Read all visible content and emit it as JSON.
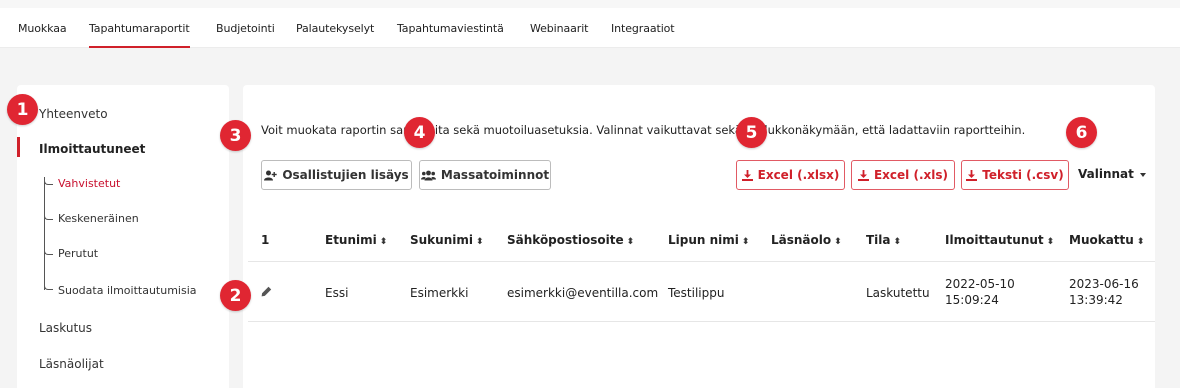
{
  "top_tabs": [
    "Muokkaa",
    "Tapahtumaraportit",
    "Budjetointi",
    "Palautekyselyt",
    "Tapahtumaviestintä",
    "Webinaarit",
    "Integraatiot"
  ],
  "active_tab_index": 1,
  "sidebar": {
    "items": [
      "Yhteenveto",
      "Ilmoittautuneet",
      "Laskutus",
      "Läsnäolijat"
    ],
    "active_item": "Ilmoittautuneet",
    "sub_items": [
      "Vahvistetut",
      "Keskeneräinen",
      "Perutut",
      "Suodata ilmoittautumisia"
    ],
    "active_sub_item": "Vahvistetut"
  },
  "info_text": "Voit muokata raportin sarakkeita sekä muotoilua­setuksia. Valinnat vaikuttavat sekä taulukkonäkymään, että ladattaviin raportteihin.",
  "buttons": {
    "add_participants": "Osallistujien lisäys",
    "bulk_actions": "Massatoiminnot",
    "excel_xlsx": "Excel (.xlsx)",
    "excel_xls": "Excel (.xls)",
    "text_csv": "Teksti (.csv)",
    "options": "Valinnat"
  },
  "table": {
    "columns": [
      "1",
      "Etunimi",
      "Sukunimi",
      "Sähköpostiosoite",
      "Lipun nimi",
      "Läsnäolo",
      "Tila",
      "Ilmoittautunut",
      "Muokattu"
    ],
    "rows": [
      {
        "first_name": "Essi",
        "last_name": "Esimerkki",
        "email": "esimerkki@eventilla.com",
        "ticket": "Testilippu",
        "attendance": "",
        "status": "Laskutettu",
        "registered_date": "2022-05-10",
        "registered_time": "15:09:24",
        "modified_date": "2023-06-16",
        "modified_time": "13:39:42"
      }
    ]
  },
  "badges": [
    "1",
    "2",
    "3",
    "4",
    "5",
    "6"
  ],
  "colors": {
    "accent": "#d0202a",
    "badge": "#e02632"
  },
  "icons": [
    "add-user-icon",
    "users-icon",
    "download-icon",
    "download-icon",
    "download-icon",
    "caret-down-icon",
    "pencil-icon",
    "sort-icon"
  ]
}
